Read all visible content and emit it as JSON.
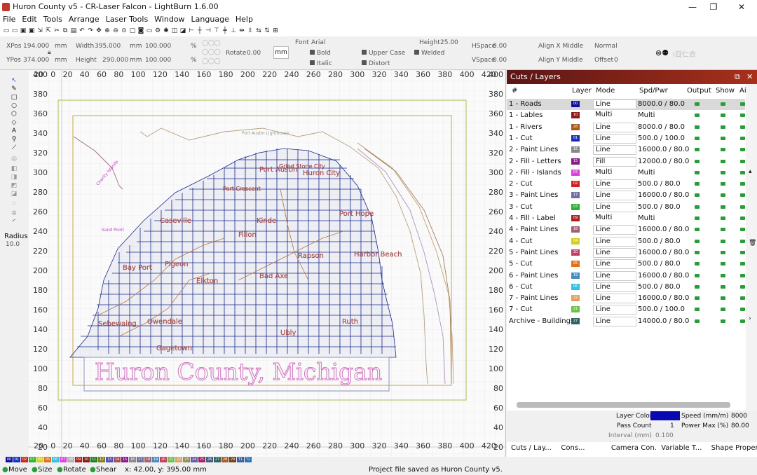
{
  "window": {
    "title": "Huron County v5 - CR-Laser Falcon - LightBurn 1.6.00",
    "min": "—",
    "max": "❐",
    "close": "✕"
  },
  "menu": [
    "File",
    "Edit",
    "Tools",
    "Arrange",
    "Laser Tools",
    "Window",
    "Language",
    "Help"
  ],
  "props": {
    "xpos_label": "XPos",
    "xpos": "194.000",
    "ypos_label": "YPos",
    "ypos": "374.000",
    "unit_mm": "mm",
    "width_label": "Width",
    "width": "395.000",
    "height_label": "Height",
    "height": "290.000",
    "pct_w": "100.000",
    "pct_h": "100.000",
    "pct": "%",
    "rotate_label": "Rotate",
    "rotate": "0.00",
    "rotate_unit": "mm",
    "font_label": "Font",
    "font": "Arial",
    "fheight_label": "Height",
    "fheight": "25.00",
    "hspace_label": "HSpace",
    "hspace": "0.00",
    "vspace_label": "VSpace",
    "vspace": "0.00",
    "bold": "Bold",
    "italic": "Italic",
    "upper": "Upper Case",
    "distort": "Distort",
    "welded": "Welded",
    "alignx": "Align X Middle",
    "aligny": "Align Y Middle",
    "normal": "Normal",
    "offset_label": "Offset",
    "offset": "0"
  },
  "left_tools": {
    "radius_label": "Radius:",
    "radius": "10.0"
  },
  "canvas": {
    "xticks": [
      "20",
      "0",
      "20",
      "40",
      "60",
      "80",
      "100",
      "120",
      "140",
      "160",
      "180",
      "200",
      "220",
      "240",
      "260",
      "280",
      "300",
      "320",
      "340",
      "360",
      "380",
      "400",
      "420"
    ],
    "yticks": [
      "400",
      "380",
      "360",
      "340",
      "320",
      "300",
      "280",
      "260",
      "240",
      "220",
      "200",
      "180",
      "160",
      "140",
      "120",
      "100",
      "80",
      "60",
      "40",
      "20"
    ],
    "map_title": "Huron County, Michigan",
    "labels": [
      "Port Austin",
      "Grind Stone City",
      "Huron City",
      "Port Crescent",
      "Caseville",
      "Port Hope",
      "Kinde",
      "Filion",
      "Harbor Beach",
      "Rapson",
      "Bay Port",
      "Pigeon",
      "Elkton",
      "Bad Axe",
      "Sebewaing",
      "Owendale",
      "Ruth",
      "Ubly",
      "Gagetown",
      "Port Austin Lighthouse",
      "Sand Point",
      "Charity Islands"
    ]
  },
  "panel": {
    "title": "Cuts / Layers",
    "headers": [
      "#",
      "Layer",
      "Mode",
      "Spd/Pwr",
      "Output",
      "Show",
      "Ai"
    ],
    "rows": [
      {
        "name": "1 - Roads",
        "num": "00",
        "color": "#1010a0",
        "mode": "Line",
        "spd": "8000.0 / 80.0"
      },
      {
        "name": "1 - Lables",
        "num": "10",
        "color": "#8a1a1a",
        "mode": "Multi",
        "spd": "Multi"
      },
      {
        "name": "1 - Rivers",
        "num": "28",
        "color": "#a85a20",
        "mode": "Line",
        "spd": "8000.0 / 80.0"
      },
      {
        "name": "1 - Cut",
        "num": "01",
        "color": "#1530c0",
        "mode": "Line",
        "spd": "500.0 / 100.0"
      },
      {
        "name": "2 - Paint Lines",
        "num": "16",
        "color": "#888888",
        "mode": "Line",
        "spd": "16000.0 / 80.0"
      },
      {
        "name": "2 - Fill - Letters",
        "num": "15",
        "color": "#8a1a8a",
        "mode": "Fill",
        "spd": "12000.0 / 80.0"
      },
      {
        "name": "2 - Fill - Islands",
        "num": "07",
        "color": "#e040e0",
        "mode": "Multi",
        "spd": "Multi"
      },
      {
        "name": "2 - Cut",
        "num": "02",
        "color": "#d02020",
        "mode": "Line",
        "spd": "500.0 / 80.0"
      },
      {
        "name": "3 - Paint Lines",
        "num": "17",
        "color": "#7070a0",
        "mode": "Line",
        "spd": "16000.0 / 80.0"
      },
      {
        "name": "3 - Cut",
        "num": "03",
        "color": "#30b030",
        "mode": "Line",
        "spd": "500.0 / 80.0"
      },
      {
        "name": "4 - Fill - Label",
        "num": "09",
        "color": "#b02020",
        "mode": "Multi",
        "spd": "Multi"
      },
      {
        "name": "4 - Paint Lines",
        "num": "18",
        "color": "#a06070",
        "mode": "Line",
        "spd": "16000.0 / 80.0"
      },
      {
        "name": "4 - Cut",
        "num": "04",
        "color": "#d0d020",
        "mode": "Line",
        "spd": "500.0 / 80.0"
      },
      {
        "name": "5 - Paint Lines",
        "num": "20",
        "color": "#c04060",
        "mode": "Line",
        "spd": "16000.0 / 80.0"
      },
      {
        "name": "5 - Cut",
        "num": "05",
        "color": "#e07020",
        "mode": "Line",
        "spd": "500.0 / 80.0"
      },
      {
        "name": "6 - Paint Lines",
        "num": "19",
        "color": "#4a8ac0",
        "mode": "Line",
        "spd": "16000.0 / 80.0"
      },
      {
        "name": "6 - Cut",
        "num": "06",
        "color": "#30c0e0",
        "mode": "Line",
        "spd": "500.0 / 80.0"
      },
      {
        "name": "7 - Paint Lines",
        "num": "22",
        "color": "#e0a060",
        "mode": "Line",
        "spd": "16000.0 / 80.0"
      },
      {
        "name": "7 - Cut",
        "num": "21",
        "color": "#70c050",
        "mode": "Line",
        "spd": "500.0 / 100.0"
      },
      {
        "name": "Archive - Buildings",
        "num": "27",
        "color": "#306060",
        "mode": "Line",
        "spd": "14000.0 / 80.0"
      }
    ],
    "layer_color_label": "Layer Color",
    "speed_label": "Speed (mm/m)",
    "speed": "8000",
    "pass_label": "Pass Count",
    "pass": "1",
    "power_label": "Power Max (%)",
    "power": "80.00",
    "interval_label": "Interval (mm)",
    "interval": "0.100"
  },
  "bottom_tabs": [
    "Cuts / Lay...",
    "Cons...",
    "Camera Con...",
    "Variable T...",
    "Shape Propert..."
  ],
  "palette": [
    {
      "n": "00",
      "c": "#1010a0"
    },
    {
      "n": "01",
      "c": "#1530c0"
    },
    {
      "n": "02",
      "c": "#d02020"
    },
    {
      "n": "03",
      "c": "#30b030"
    },
    {
      "n": "04",
      "c": "#d0d020"
    },
    {
      "n": "05",
      "c": "#e07020"
    },
    {
      "n": "06",
      "c": "#30c0e0"
    },
    {
      "n": "07",
      "c": "#e040e0"
    },
    {
      "n": "08",
      "c": "#b0b0b0"
    },
    {
      "n": "09",
      "c": "#b02020"
    },
    {
      "n": "10",
      "c": "#8a1a1a"
    },
    {
      "n": "11",
      "c": "#208020"
    },
    {
      "n": "12",
      "c": "#808020"
    },
    {
      "n": "13",
      "c": "#5050c0"
    },
    {
      "n": "14",
      "c": "#a05050"
    },
    {
      "n": "15",
      "c": "#8a1a8a"
    },
    {
      "n": "16",
      "c": "#888888"
    },
    {
      "n": "17",
      "c": "#7070a0"
    },
    {
      "n": "18",
      "c": "#a06070"
    },
    {
      "n": "19",
      "c": "#4a8ac0"
    },
    {
      "n": "20",
      "c": "#c04060"
    },
    {
      "n": "21",
      "c": "#70c050"
    },
    {
      "n": "22",
      "c": "#e0a060"
    },
    {
      "n": "23",
      "c": "#909060"
    },
    {
      "n": "24",
      "c": "#6060a0"
    },
    {
      "n": "25",
      "c": "#a02060"
    },
    {
      "n": "26",
      "c": "#406080"
    },
    {
      "n": "27",
      "c": "#306060"
    },
    {
      "n": "28",
      "c": "#a85a20"
    },
    {
      "n": "29",
      "c": "#704020"
    },
    {
      "n": "T1",
      "c": "#4060a0"
    },
    {
      "n": "T2",
      "c": "#3070b0"
    }
  ],
  "status": {
    "move": "Move",
    "size": "Size",
    "rotate": "Rotate",
    "shear": "Shear",
    "coords": "x: 42.00, y: 395.00 mm",
    "message": "Project file saved as Huron County v5."
  }
}
